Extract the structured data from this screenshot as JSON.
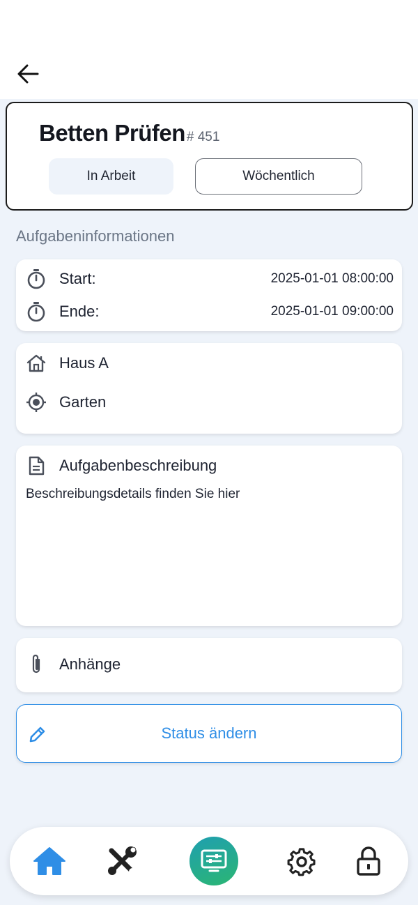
{
  "header": {
    "back_icon": "arrow-left-icon"
  },
  "task": {
    "title": "Betten Prüfen",
    "number": "# 451",
    "status": "In Arbeit",
    "frequency": "Wöchentlich"
  },
  "info": {
    "section_label": "Aufgabeninformationen",
    "start_label": "Start:",
    "start_value": "2025-01-01 08:00:00",
    "end_label": "Ende:",
    "end_value": "2025-01-01 09:00:00",
    "building": "Haus A",
    "location": "Garten",
    "description_title": "Aufgabenbeschreibung",
    "description_text": "Beschreibungsdetails finden Sie hier",
    "attachments_label": "Anhänge"
  },
  "actions": {
    "status_button": "Status ändern"
  },
  "nav": {
    "items": [
      "home-icon",
      "tools-icon",
      "tasks-icon",
      "settings-icon",
      "lock-icon"
    ],
    "active": "home-icon"
  },
  "colors": {
    "accent": "#2f8ee6",
    "background": "#eef3fa",
    "center_gradient_start": "#1f9fb0",
    "center_gradient_end": "#2bb673"
  }
}
